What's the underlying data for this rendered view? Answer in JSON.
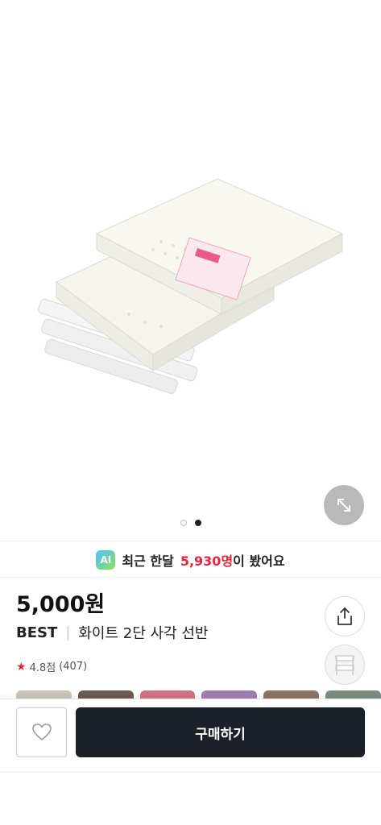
{
  "gallery": {
    "image_alt": "white two-tier square shelf baskets",
    "dots": [
      false,
      true
    ]
  },
  "recent_views": {
    "badge": "AI",
    "prefix": "최근 한달",
    "count": "5,930명",
    "suffix": "이 봤어요"
  },
  "product": {
    "price": "5,000원",
    "tag": "BEST",
    "name": "화이트 2단 사각 선반",
    "rating": "4.8점",
    "review_count": "(407)"
  },
  "bottom_bar": {
    "buy_label": "구매하기"
  },
  "colors": {
    "accent_red": "#e8243c",
    "buy_button": "#1b2029"
  }
}
